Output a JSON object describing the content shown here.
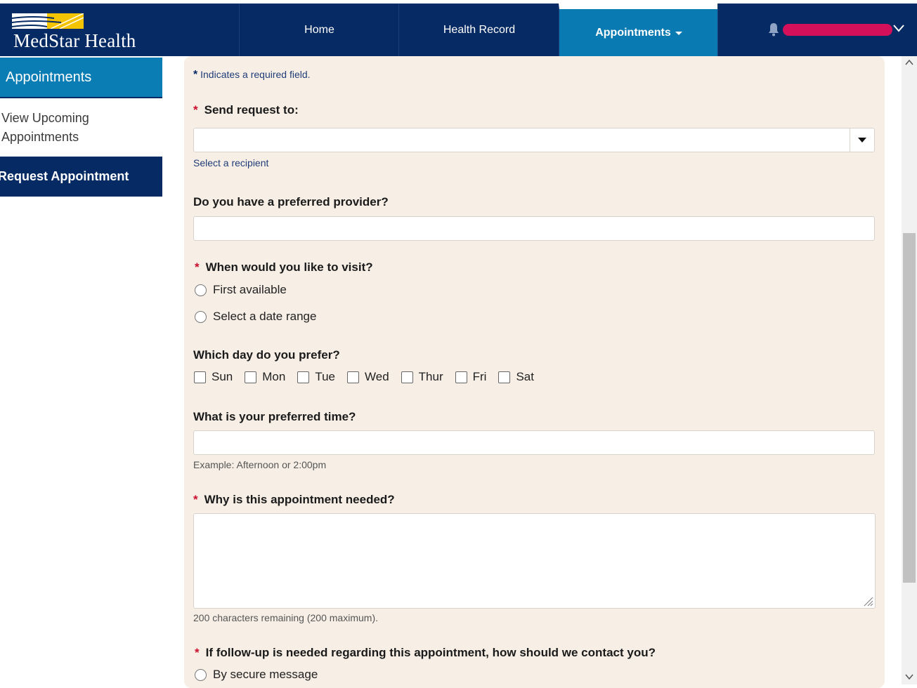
{
  "brand": {
    "name": "MedStar Health"
  },
  "nav": {
    "home": "Home",
    "health_record": "Health Record",
    "appointments": "Appointments"
  },
  "sidebar": {
    "heading": "Appointments",
    "view_upcoming": "View Upcoming Appointments",
    "request": "Request Appointment"
  },
  "form": {
    "required_note": "Indicates a required field.",
    "required_marker": "*",
    "send_to_label": "Send request to:",
    "send_to_value": "",
    "send_to_hint": "Select a recipient",
    "provider_label": "Do you have a preferred provider?",
    "provider_value": "",
    "visit_label": "When would you like to visit?",
    "visit_options": [
      "First available",
      "Select a date range"
    ],
    "day_label": "Which day do you prefer?",
    "days": [
      "Sun",
      "Mon",
      "Tue",
      "Wed",
      "Thur",
      "Fri",
      "Sat"
    ],
    "time_label": "What is your preferred time?",
    "time_value": "",
    "time_hint": "Example: Afternoon or 2:00pm",
    "reason_label": "Why is this appointment needed?",
    "reason_value": "",
    "reason_counter": "200 characters remaining (200 maximum).",
    "followup_label": "If follow-up is needed regarding this appointment, how should we contact you?",
    "followup_options": [
      "By secure message"
    ]
  },
  "colors": {
    "navy": "#062a63",
    "accent_blue": "#0b7db5",
    "panel": "#f7efe6",
    "required_red": "#c8102e",
    "redaction": "#d4105a"
  }
}
